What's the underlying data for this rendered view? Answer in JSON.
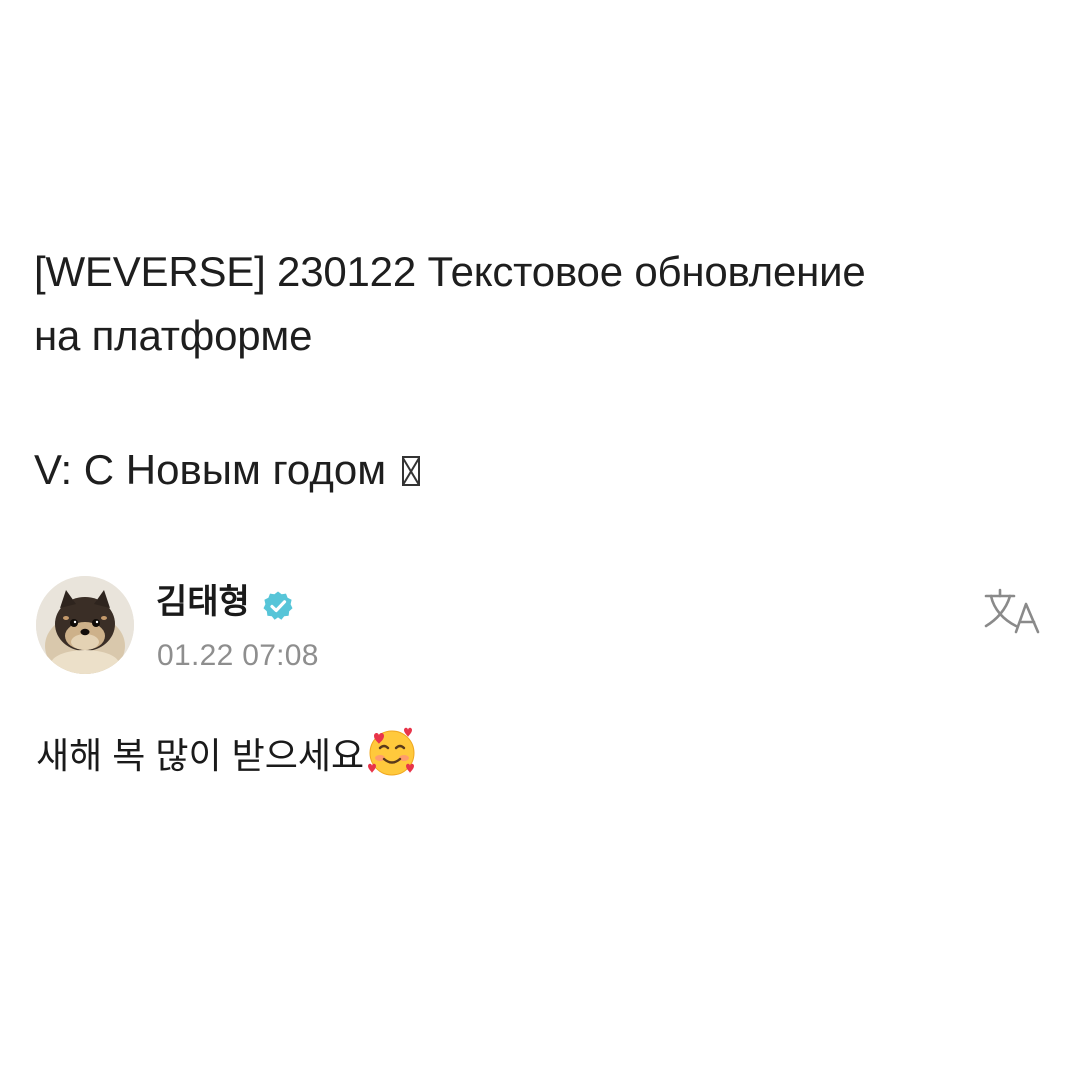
{
  "caption": {
    "line1": "[WEVERSE] 230122 Текстовое обновление",
    "line2": "на платформе",
    "greeting": "V: С Новым годом"
  },
  "post": {
    "author": "김태형",
    "timestamp": "01.22 07:08",
    "body": "새해 복 많이 받으세요",
    "emoji": "smiling-face-with-hearts",
    "avatar": "pomeranian-dog-avatar"
  },
  "icons": {
    "verified": "verified-badge-icon",
    "translate": "translate-icon"
  },
  "colors": {
    "background": "#ffffff",
    "text": "#1e1e1e",
    "timestamp": "#8e8e8e",
    "verified": "#4fc3d6",
    "translate_icon": "#8a8a8a"
  }
}
